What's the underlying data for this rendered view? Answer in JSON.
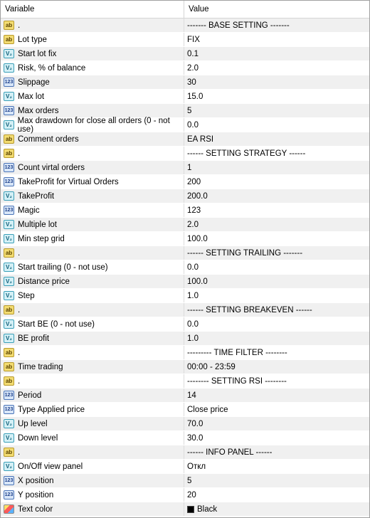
{
  "header": {
    "variable": "Variable",
    "value": "Value"
  },
  "rows": [
    {
      "icon": "ab",
      "name": ".",
      "value": "------- BASE SETTING -------"
    },
    {
      "icon": "ab",
      "name": "Lot type",
      "value": "FIX"
    },
    {
      "icon": "dbl",
      "name": "Start lot fix",
      "value": "0.1"
    },
    {
      "icon": "dbl",
      "name": "Risk, % of balance",
      "value": "2.0"
    },
    {
      "icon": "int",
      "name": "Slippage",
      "value": "30"
    },
    {
      "icon": "dbl",
      "name": "Max lot",
      "value": "15.0"
    },
    {
      "icon": "int",
      "name": "Max orders",
      "value": "5"
    },
    {
      "icon": "dbl",
      "name": "Max drawdown for close all orders (0 - not use)",
      "value": "0.0"
    },
    {
      "icon": "ab",
      "name": "Comment orders",
      "value": "EA RSI"
    },
    {
      "icon": "ab",
      "name": ".",
      "value": "------ SETTING STRATEGY ------"
    },
    {
      "icon": "int",
      "name": "Count virtal orders",
      "value": "1"
    },
    {
      "icon": "int",
      "name": "TakeProfit for Virtual Orders",
      "value": "200"
    },
    {
      "icon": "dbl",
      "name": "TakeProfit",
      "value": "200.0"
    },
    {
      "icon": "int",
      "name": "Magic",
      "value": "123"
    },
    {
      "icon": "dbl",
      "name": "Multiple lot",
      "value": "2.0"
    },
    {
      "icon": "dbl",
      "name": "Min step grid",
      "value": "100.0"
    },
    {
      "icon": "ab",
      "name": ".",
      "value": "------ SETTING TRAILING -------"
    },
    {
      "icon": "dbl",
      "name": "Start trailing (0 - not use)",
      "value": "0.0"
    },
    {
      "icon": "dbl",
      "name": "Distance price",
      "value": "100.0"
    },
    {
      "icon": "dbl",
      "name": "Step",
      "value": "1.0"
    },
    {
      "icon": "ab",
      "name": ".",
      "value": "------ SETTING BREAKEVEN ------"
    },
    {
      "icon": "dbl",
      "name": "Start BE (0 - not use)",
      "value": "0.0"
    },
    {
      "icon": "dbl",
      "name": "BE profit",
      "value": "1.0"
    },
    {
      "icon": "ab",
      "name": ".",
      "value": "--------- TIME FILTER --------"
    },
    {
      "icon": "ab",
      "name": "Time trading",
      "value": "00:00 - 23:59"
    },
    {
      "icon": "ab",
      "name": ".",
      "value": "-------- SETTING RSI --------"
    },
    {
      "icon": "int",
      "name": "Period",
      "value": "14"
    },
    {
      "icon": "int",
      "name": "Type Applied price",
      "value": "Close price"
    },
    {
      "icon": "dbl",
      "name": "Up level",
      "value": "70.0"
    },
    {
      "icon": "dbl",
      "name": "Down level",
      "value": "30.0"
    },
    {
      "icon": "ab",
      "name": ".",
      "value": "------ INFO PANEL ------"
    },
    {
      "icon": "dbl",
      "name": "On/Off view panel",
      "value": "Откл"
    },
    {
      "icon": "int",
      "name": "X position",
      "value": "5"
    },
    {
      "icon": "int",
      "name": "Y position",
      "value": "20"
    },
    {
      "icon": "clr",
      "name": "Text color",
      "value": "Black",
      "swatch": "#000000"
    }
  ],
  "icon_labels": {
    "ab": "ab",
    "int": "123",
    "dbl": "V₂",
    "clr": ""
  }
}
